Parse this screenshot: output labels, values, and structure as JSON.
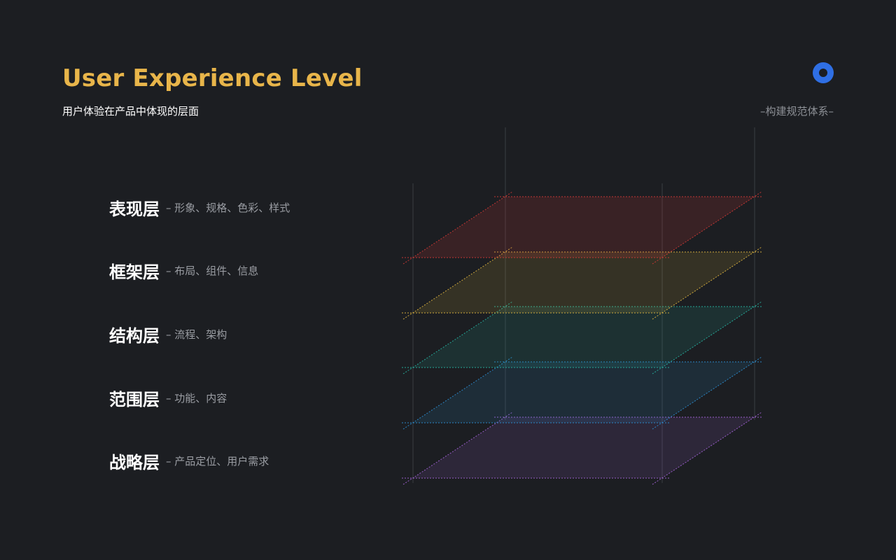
{
  "header": {
    "title": "User Experience Level",
    "subtitle": "用户体验在产品中体现的层面",
    "tagline": "–构建规范体系–"
  },
  "logo": {
    "icon": "ring-logo-icon",
    "color": "#2f6fe4"
  },
  "layers": [
    {
      "name": "表现层",
      "desc": "– 形象、规格、色彩、样式",
      "color": "#d23a36"
    },
    {
      "name": "框架层",
      "desc": "– 布局、组件、信息",
      "color": "#e0b640"
    },
    {
      "name": "结构层",
      "desc": "– 流程、架构",
      "color": "#27b4a2"
    },
    {
      "name": "范围层",
      "desc": "– 功能、内容",
      "color": "#2c8fd4"
    },
    {
      "name": "战略层",
      "desc": "– 产品定位、用户需求",
      "color": "#a463d8"
    }
  ]
}
